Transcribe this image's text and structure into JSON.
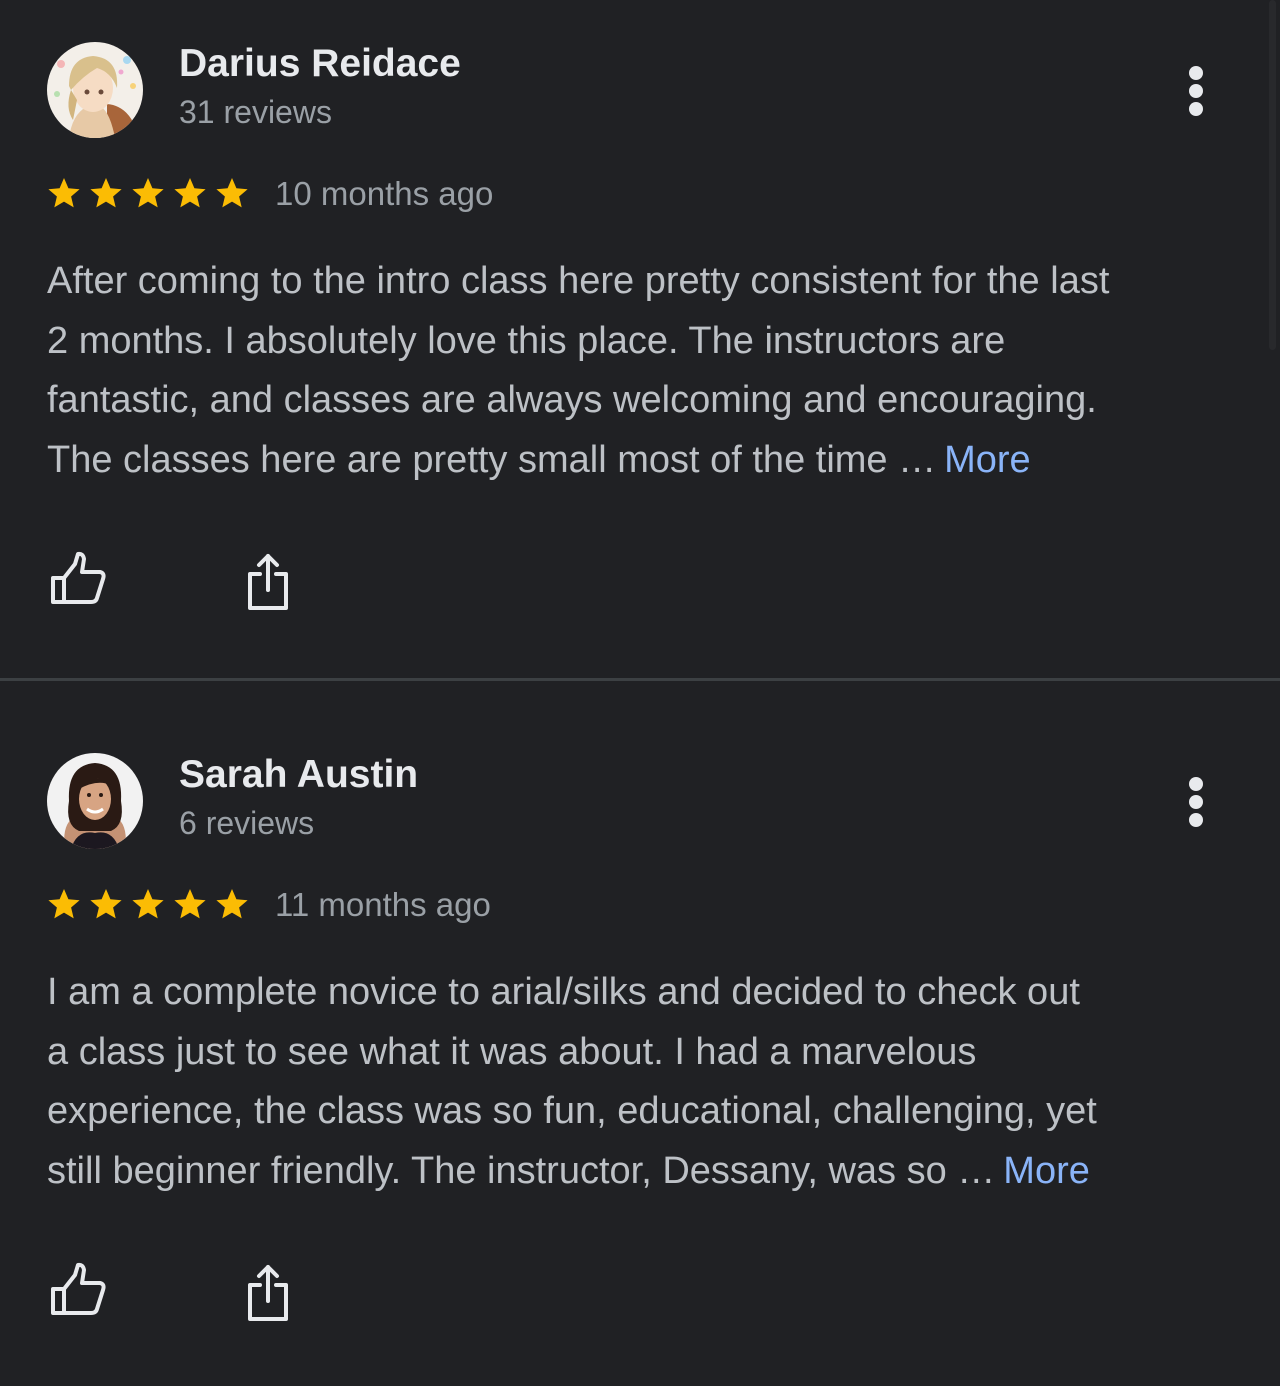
{
  "reviews": [
    {
      "author": "Darius Reidace",
      "review_count": "31 reviews",
      "rating": 5,
      "time": "10 months ago",
      "text_lines": [
        "After coming to the intro class here pretty consistent for the last",
        "2 months. I absolutely love this place. The instructors are",
        "fantastic, and classes are always welcoming and encouraging.",
        "The classes here are pretty small most of the time …"
      ],
      "more_label": "More",
      "avatar_icon": "anime-avatar"
    },
    {
      "author": "Sarah Austin",
      "review_count": "6 reviews",
      "rating": 5,
      "time": "11 months ago",
      "text_lines": [
        "I am a complete novice to arial/silks and decided to check out",
        "a class just to see what it was about. I had a marvelous",
        "experience, the class was so fun, educational, challenging, yet",
        "still beginner friendly. The instructor, Dessany, was so …"
      ],
      "more_label": "More",
      "avatar_icon": "photo-avatar"
    }
  ],
  "icons": {
    "menu": "more-vertical-icon",
    "like": "thumbs-up-icon",
    "share": "share-icon",
    "star": "star-icon"
  },
  "colors": {
    "background": "#202124",
    "star": "#fbbc04",
    "link": "#8ab4f8",
    "divider": "#3c4043"
  }
}
